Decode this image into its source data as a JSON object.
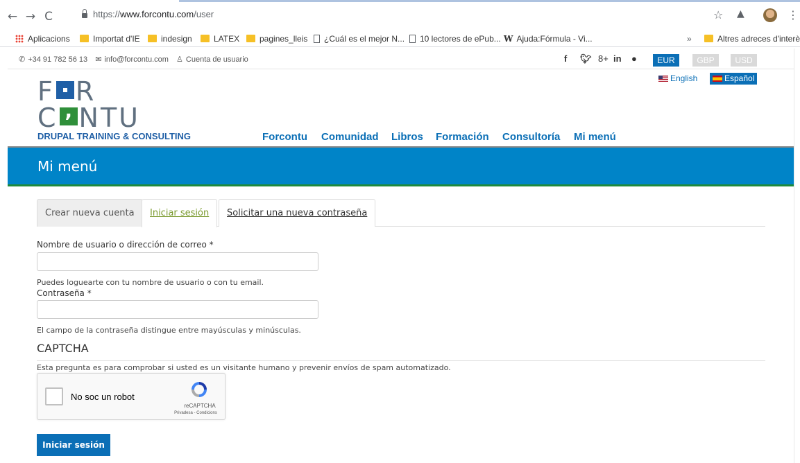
{
  "browser": {
    "url_proto": "https://",
    "url_host": "www.forcontu.com",
    "url_path": "/user",
    "bookmarks": [
      "Aplicacions",
      "Importat d'IE",
      "indesign",
      "LATEX",
      "pagines_lleis",
      "¿Cuál es el mejor N...",
      "10 lectores de ePub...",
      "Ajuda:Fórmula - Vi...",
      "Altres adreces d'interès"
    ],
    "bookmarks_overflow": "»"
  },
  "topbar": {
    "phone": "+34 91 782 56 13",
    "email": "info@forcontu.com",
    "account": "Cuenta de usuario",
    "social": [
      "f",
      "t",
      "8+",
      "in",
      "r"
    ],
    "currencies": [
      "EUR",
      "GBP",
      "USD"
    ]
  },
  "header": {
    "logo_row1_a": "F",
    "logo_row1_b": "R",
    "logo_row2_a": "C",
    "logo_row2_b": "NTU",
    "tagline": "DRUPAL TRAINING & CONSULTING",
    "lang_en": "English",
    "lang_es": "Español",
    "nav": [
      "Forcontu",
      "Comunidad",
      "Libros",
      "Formación",
      "Consultoría",
      "Mi menú"
    ]
  },
  "banner": {
    "title": "Mi menú"
  },
  "tabs": [
    "Crear nueva cuenta",
    "Iniciar sesión",
    "Solicitar una nueva contraseña"
  ],
  "form": {
    "username_label": "Nombre de usuario o dirección de correo *",
    "username_value": "",
    "username_help": "Puedes loguearte con tu nombre de usuario o con tu email.",
    "password_label": "Contraseña *",
    "password_value": "",
    "password_help": "El campo de la contraseña distingue entre mayúsculas y minúsculas.",
    "captcha_title": "CAPTCHA",
    "captcha_desc": "Esta pregunta es para comprobar si usted es un visitante humano y prevenir envíos de spam automatizado.",
    "recaptcha_label": "No soc un robot",
    "recaptcha_brand": "reCAPTCHA",
    "recaptcha_terms": "Privadesa - Condicions",
    "submit_label": "Iniciar sesión"
  },
  "colors": {
    "brand_blue": "#0b6fb6",
    "banner_blue": "#0084c8",
    "brand_green": "#1d8a3d"
  }
}
